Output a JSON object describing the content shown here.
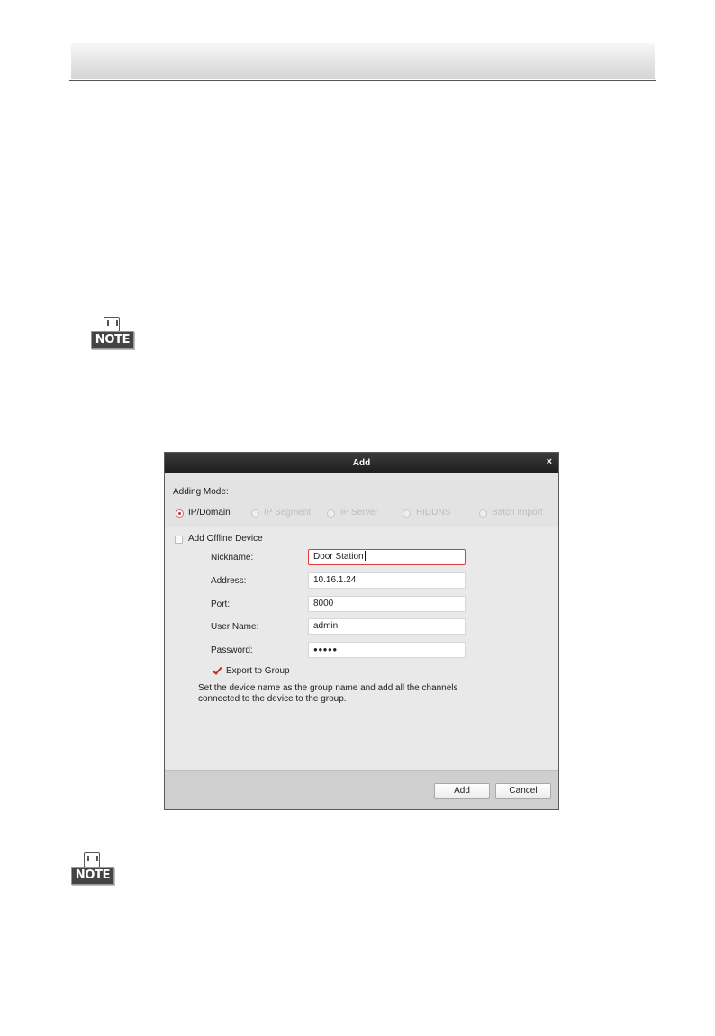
{
  "dialog": {
    "title": "Add",
    "close_glyph": "×",
    "adding_mode_label": "Adding Mode:",
    "modes": [
      {
        "label": "IP/Domain",
        "selected": true
      },
      {
        "label": "IP Segment",
        "selected": false
      },
      {
        "label": "IP Server",
        "selected": false
      },
      {
        "label": "HIDDNS",
        "selected": false
      },
      {
        "label": "Batch Import",
        "selected": false
      }
    ],
    "offline_label": "Add Offline Device",
    "offline_checked": false,
    "fields": {
      "nickname": {
        "label": "Nickname:",
        "value": "Door Station"
      },
      "address": {
        "label": "Address:",
        "value": "10.16.1.24"
      },
      "port": {
        "label": "Port:",
        "value": "8000"
      },
      "username": {
        "label": "User Name:",
        "value": "admin"
      },
      "password": {
        "label": "Password:",
        "value": "●●●●●"
      }
    },
    "export_label": "Export to Group",
    "export_checked": true,
    "description": "Set the device name as the group name and add all the channels connected to the device to the group.",
    "add_button": "Add",
    "cancel_button": "Cancel"
  },
  "notes": {
    "icon_text": "NOTE"
  },
  "icons": {
    "note": "note-icon",
    "close": "close-icon"
  },
  "colors": {
    "titlebar": "#2b2b2b",
    "accent_red": "#e03a3a",
    "dialog_bg": "#e9e9e9",
    "footer_bg": "#cfcfcf"
  }
}
